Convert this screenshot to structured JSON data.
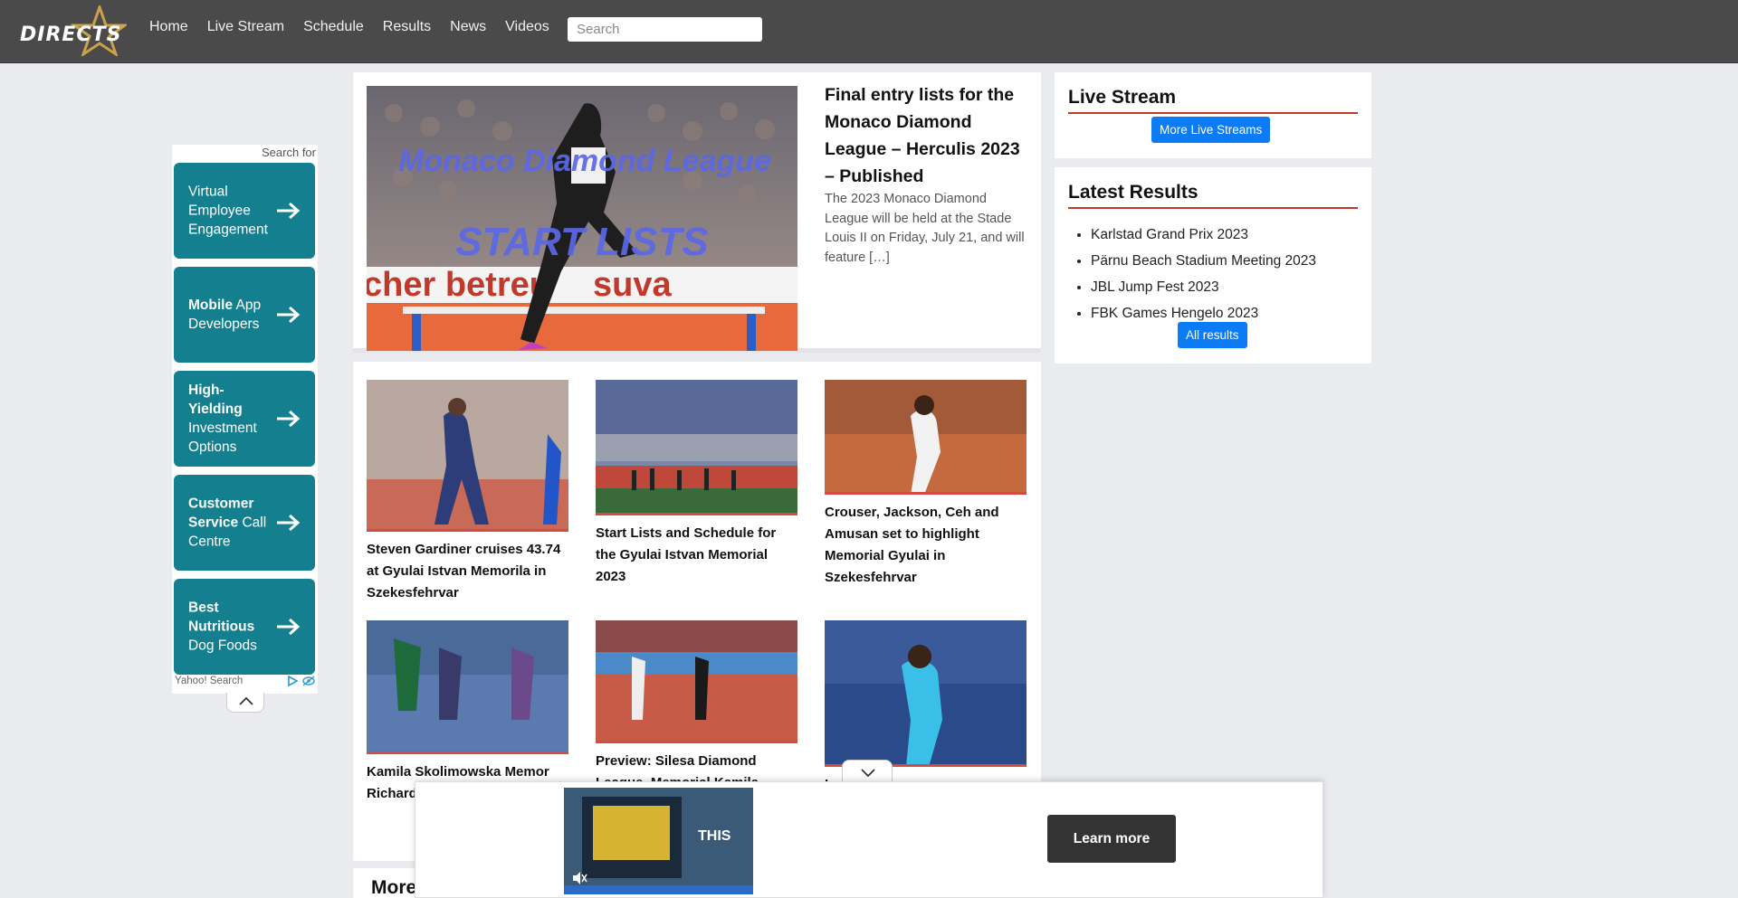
{
  "nav": {
    "logo_text": "DIRECTS",
    "links": [
      "Home",
      "Live Stream",
      "Schedule",
      "Results",
      "News",
      "Videos"
    ],
    "search_placeholder": "Search"
  },
  "left_ad": {
    "search_for": "Search for",
    "tiles": [
      {
        "bold": "",
        "text": "Virtual Employee Engagement",
        "bold_part": "Virtual Employee Engagement"
      },
      {
        "bold": "Mobile",
        "rest": " App Developers"
      },
      {
        "bold": "High-Yielding",
        "rest": " Investment Options"
      },
      {
        "bold": "Customer Service",
        "rest": " Call Centre"
      },
      {
        "bold": "Best Nutritious",
        "rest": " Dog Foods"
      }
    ],
    "footer": "Yahoo! Search"
  },
  "featured": {
    "image_title_1": "Monaco Diamond League",
    "image_title_2": "START LISTS",
    "image_banner_1": "cher betreu",
    "image_banner_2": "suva",
    "title": "Final entry lists for the Monaco Diamond League – Herculis 2023 – Published",
    "excerpt": "The 2023 Monaco Diamond League will be held at the Stade Louis II on Friday, July 21, and will feature […]"
  },
  "cards": [
    {
      "title": "Steven Gardiner cruises 43.74 at Gyulai Istvan Memorila in Szekesfehrvar"
    },
    {
      "title": "Start Lists and Schedule for the Gyulai Istvan Memorial 2023"
    },
    {
      "title": "Crouser, Jackson, Ceh and Amusan set to highlight Memorial Gyulai in Szekesfehrvar"
    },
    {
      "title": "Kamila Skolimowska Memor Richard Impres"
    },
    {
      "title": "Preview: Silesa Diamond League, Memorial Kamila"
    },
    {
      "title": "L"
    }
  ],
  "more": {
    "title": "More"
  },
  "live_stream": {
    "title": "Live Stream",
    "button": "More Live Streams"
  },
  "latest_results": {
    "title": "Latest Results",
    "items": [
      "Karlstad Grand Prix 2023",
      "Pärnu Beach Stadium Meeting 2023",
      "JBL Jump Fest 2023",
      "FBK Games Hengelo 2023"
    ],
    "button": "All results"
  },
  "bottom_ad": {
    "video_text": "THIS",
    "button": "Learn more"
  },
  "colors": {
    "navbar": "#4a4a4a",
    "ad_tile": "#14808f",
    "accent_red": "#c0392b",
    "button_blue": "#0b7cf5"
  }
}
